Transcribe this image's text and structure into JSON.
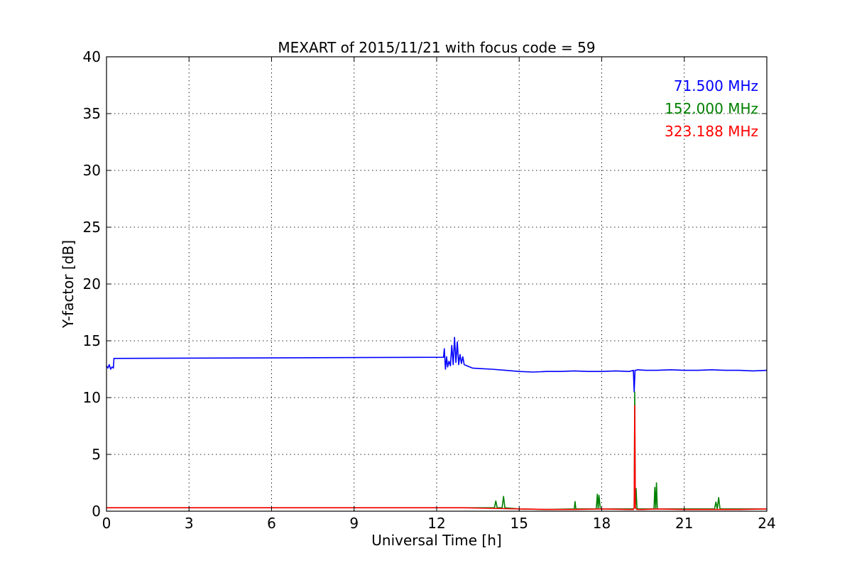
{
  "chart_data": {
    "type": "line",
    "title": "MEXART of 2015/11/21 with focus code = 59",
    "xlabel": "Universal Time [h]",
    "ylabel": "Y-factor [dB]",
    "xlim": [
      0,
      24
    ],
    "ylim": [
      0,
      40
    ],
    "xticks": [
      0,
      3,
      6,
      9,
      12,
      15,
      18,
      21,
      24
    ],
    "yticks": [
      0,
      5,
      10,
      15,
      20,
      25,
      30,
      35,
      40
    ],
    "grid": true,
    "legend_placement": "top-right",
    "series": [
      {
        "name": "71.500 MHz",
        "color": "#0000ff",
        "x": [
          0.0,
          0.05,
          0.1,
          0.15,
          0.2,
          0.25,
          0.27,
          12.25,
          12.28,
          12.32,
          12.36,
          12.4,
          12.45,
          12.5,
          12.55,
          12.6,
          12.65,
          12.7,
          12.75,
          12.8,
          12.85,
          12.9,
          12.95,
          13.0,
          13.3,
          13.6,
          14.0,
          14.5,
          15.0,
          15.5,
          16.0,
          16.5,
          17.0,
          17.5,
          18.0,
          18.5,
          19.0,
          19.15,
          19.18,
          19.21,
          19.24,
          19.3,
          19.6,
          20.0,
          20.5,
          21.0,
          21.5,
          22.0,
          22.5,
          23.0,
          23.5,
          24.0
        ],
        "y": [
          12.8,
          12.6,
          12.9,
          12.5,
          12.7,
          12.6,
          13.45,
          13.55,
          14.3,
          12.5,
          13.6,
          12.7,
          13.2,
          12.8,
          14.6,
          12.9,
          15.3,
          13.1,
          14.9,
          12.9,
          13.8,
          13.0,
          13.6,
          12.9,
          12.6,
          12.55,
          12.5,
          12.4,
          12.3,
          12.25,
          12.3,
          12.3,
          12.35,
          12.3,
          12.3,
          12.35,
          12.3,
          12.4,
          10.5,
          12.4,
          12.4,
          12.45,
          12.4,
          12.4,
          12.45,
          12.4,
          12.4,
          12.45,
          12.4,
          12.4,
          12.35,
          12.4
        ]
      },
      {
        "name": "152.000 MHz",
        "color": "#008000",
        "x": [
          0.0,
          12.25,
          14.0,
          14.1,
          14.15,
          14.2,
          14.3,
          14.38,
          14.43,
          14.48,
          15.0,
          16.0,
          17.0,
          17.03,
          17.06,
          17.1,
          17.5,
          17.8,
          17.84,
          17.87,
          17.9,
          17.95,
          18.5,
          19.0,
          19.15,
          19.18,
          19.2,
          19.22,
          19.25,
          19.28,
          19.3,
          19.5,
          19.9,
          19.93,
          19.96,
          19.99,
          20.02,
          20.05,
          20.5,
          21.0,
          22.0,
          22.1,
          22.15,
          22.2,
          22.25,
          22.3,
          23.0,
          24.0
        ],
        "y": [
          0.3,
          0.3,
          0.3,
          0.3,
          0.9,
          0.3,
          0.3,
          0.3,
          1.3,
          0.3,
          0.2,
          0.15,
          0.2,
          0.85,
          0.2,
          0.2,
          0.2,
          0.2,
          1.5,
          0.2,
          1.4,
          0.2,
          0.2,
          0.2,
          0.2,
          0.3,
          10.5,
          0.3,
          2.0,
          0.3,
          0.2,
          0.2,
          0.2,
          2.1,
          0.2,
          2.5,
          0.2,
          0.2,
          0.2,
          0.2,
          0.2,
          0.2,
          0.8,
          0.2,
          1.2,
          0.2,
          0.2,
          0.2
        ]
      },
      {
        "name": "323.188 MHz",
        "color": "#ff0000",
        "x": [
          0.0,
          12.25,
          13.0,
          14.0,
          15.0,
          16.0,
          17.0,
          18.0,
          19.0,
          19.15,
          19.18,
          19.2,
          19.22,
          19.25,
          19.3,
          19.5,
          20.0,
          21.0,
          22.0,
          23.0,
          24.0
        ],
        "y": [
          0.3,
          0.3,
          0.3,
          0.25,
          0.2,
          0.15,
          0.15,
          0.2,
          0.15,
          0.15,
          0.3,
          9.3,
          0.3,
          0.2,
          0.15,
          0.15,
          0.2,
          0.15,
          0.15,
          0.15,
          0.2
        ]
      }
    ]
  }
}
